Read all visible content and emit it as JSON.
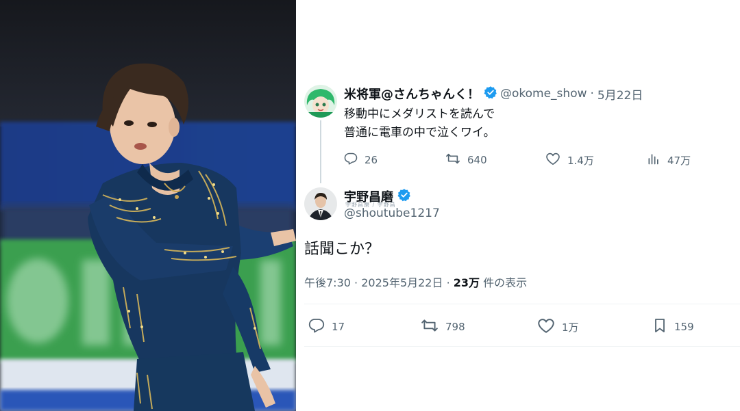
{
  "quoted_tweet": {
    "display_name": "米将軍@さんちゃんく！",
    "handle": "@okome_show",
    "separator": "·",
    "date": "5月22日",
    "lines": [
      "移動中にメダリストを読んで",
      "普通に電車の中で泣くワイ。"
    ],
    "actions": {
      "replies": "26",
      "retweets": "640",
      "likes": "1.4万",
      "views": "47万"
    }
  },
  "main_tweet": {
    "display_name": "宇野昌磨",
    "handle": "@shoutube1217",
    "sub_label": "宇野昌磨 / 宇野昌",
    "text": "話聞こか？",
    "time": "午後7:30",
    "separator": "·",
    "date": "2025年5月22日",
    "separator2": "·",
    "views_count": "23万",
    "views_label": "件の表示",
    "actions": {
      "replies": "17",
      "retweets": "798",
      "likes": "1万",
      "bookmarks": "159"
    }
  },
  "colors": {
    "verified": "#1d9bf0",
    "secondary_text": "#536471",
    "costume": "#16365f",
    "photo_green": "#2fa24a",
    "photo_blue_band": "#1c3d8a"
  },
  "icons": [
    "reply-icon",
    "retweet-icon",
    "like-icon",
    "views-icon",
    "bookmark-icon",
    "verified-badge-icon"
  ]
}
